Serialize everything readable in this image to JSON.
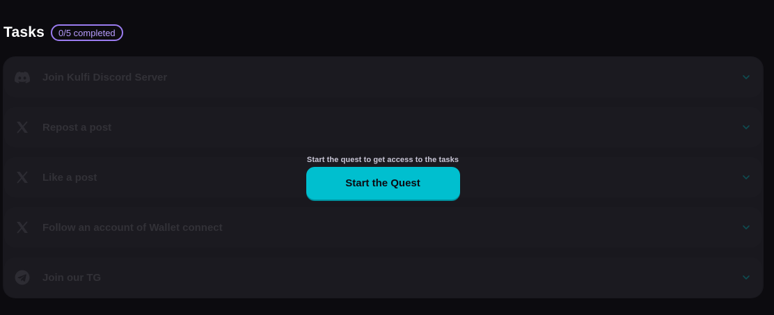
{
  "header": {
    "title": "Tasks",
    "progress_badge": "0/5 completed"
  },
  "tasks": [
    {
      "label": "Join Kulfi Discord Server",
      "icon": "discord-icon"
    },
    {
      "label": "Repost a post",
      "icon": "x-icon"
    },
    {
      "label": "Like a post",
      "icon": "x-icon"
    },
    {
      "label": "Follow an account of Wallet connect",
      "icon": "x-icon"
    },
    {
      "label": "Join our TG",
      "icon": "telegram-icon"
    }
  ],
  "locked_overlay": {
    "message": "Start the quest to get access to the tasks",
    "button_label": "Start the Quest"
  },
  "colors": {
    "background": "#0c0b0f",
    "panel": "#1b1a20",
    "accent_badge": "#9b7cf0",
    "button": "#00bfcf",
    "chevron": "#0e5a5f"
  }
}
